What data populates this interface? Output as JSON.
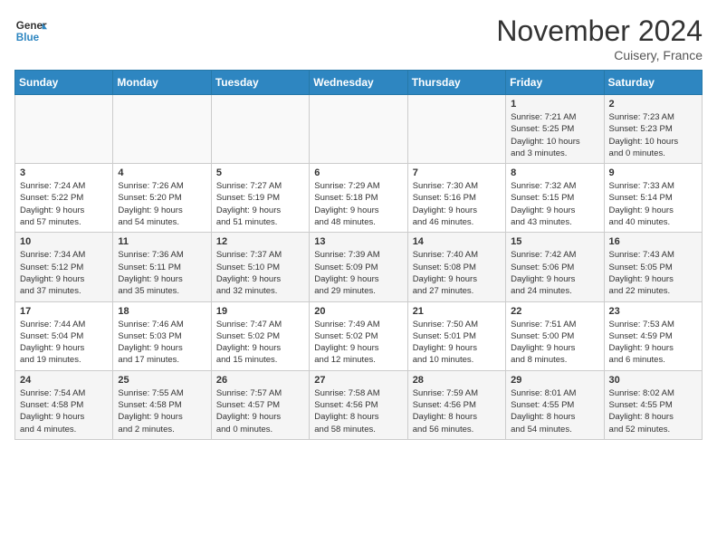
{
  "header": {
    "logo_line1": "General",
    "logo_line2": "Blue",
    "month": "November 2024",
    "location": "Cuisery, France"
  },
  "weekdays": [
    "Sunday",
    "Monday",
    "Tuesday",
    "Wednesday",
    "Thursday",
    "Friday",
    "Saturday"
  ],
  "weeks": [
    [
      {
        "day": "",
        "info": ""
      },
      {
        "day": "",
        "info": ""
      },
      {
        "day": "",
        "info": ""
      },
      {
        "day": "",
        "info": ""
      },
      {
        "day": "",
        "info": ""
      },
      {
        "day": "1",
        "info": "Sunrise: 7:21 AM\nSunset: 5:25 PM\nDaylight: 10 hours\nand 3 minutes."
      },
      {
        "day": "2",
        "info": "Sunrise: 7:23 AM\nSunset: 5:23 PM\nDaylight: 10 hours\nand 0 minutes."
      }
    ],
    [
      {
        "day": "3",
        "info": "Sunrise: 7:24 AM\nSunset: 5:22 PM\nDaylight: 9 hours\nand 57 minutes."
      },
      {
        "day": "4",
        "info": "Sunrise: 7:26 AM\nSunset: 5:20 PM\nDaylight: 9 hours\nand 54 minutes."
      },
      {
        "day": "5",
        "info": "Sunrise: 7:27 AM\nSunset: 5:19 PM\nDaylight: 9 hours\nand 51 minutes."
      },
      {
        "day": "6",
        "info": "Sunrise: 7:29 AM\nSunset: 5:18 PM\nDaylight: 9 hours\nand 48 minutes."
      },
      {
        "day": "7",
        "info": "Sunrise: 7:30 AM\nSunset: 5:16 PM\nDaylight: 9 hours\nand 46 minutes."
      },
      {
        "day": "8",
        "info": "Sunrise: 7:32 AM\nSunset: 5:15 PM\nDaylight: 9 hours\nand 43 minutes."
      },
      {
        "day": "9",
        "info": "Sunrise: 7:33 AM\nSunset: 5:14 PM\nDaylight: 9 hours\nand 40 minutes."
      }
    ],
    [
      {
        "day": "10",
        "info": "Sunrise: 7:34 AM\nSunset: 5:12 PM\nDaylight: 9 hours\nand 37 minutes."
      },
      {
        "day": "11",
        "info": "Sunrise: 7:36 AM\nSunset: 5:11 PM\nDaylight: 9 hours\nand 35 minutes."
      },
      {
        "day": "12",
        "info": "Sunrise: 7:37 AM\nSunset: 5:10 PM\nDaylight: 9 hours\nand 32 minutes."
      },
      {
        "day": "13",
        "info": "Sunrise: 7:39 AM\nSunset: 5:09 PM\nDaylight: 9 hours\nand 29 minutes."
      },
      {
        "day": "14",
        "info": "Sunrise: 7:40 AM\nSunset: 5:08 PM\nDaylight: 9 hours\nand 27 minutes."
      },
      {
        "day": "15",
        "info": "Sunrise: 7:42 AM\nSunset: 5:06 PM\nDaylight: 9 hours\nand 24 minutes."
      },
      {
        "day": "16",
        "info": "Sunrise: 7:43 AM\nSunset: 5:05 PM\nDaylight: 9 hours\nand 22 minutes."
      }
    ],
    [
      {
        "day": "17",
        "info": "Sunrise: 7:44 AM\nSunset: 5:04 PM\nDaylight: 9 hours\nand 19 minutes."
      },
      {
        "day": "18",
        "info": "Sunrise: 7:46 AM\nSunset: 5:03 PM\nDaylight: 9 hours\nand 17 minutes."
      },
      {
        "day": "19",
        "info": "Sunrise: 7:47 AM\nSunset: 5:02 PM\nDaylight: 9 hours\nand 15 minutes."
      },
      {
        "day": "20",
        "info": "Sunrise: 7:49 AM\nSunset: 5:02 PM\nDaylight: 9 hours\nand 12 minutes."
      },
      {
        "day": "21",
        "info": "Sunrise: 7:50 AM\nSunset: 5:01 PM\nDaylight: 9 hours\nand 10 minutes."
      },
      {
        "day": "22",
        "info": "Sunrise: 7:51 AM\nSunset: 5:00 PM\nDaylight: 9 hours\nand 8 minutes."
      },
      {
        "day": "23",
        "info": "Sunrise: 7:53 AM\nSunset: 4:59 PM\nDaylight: 9 hours\nand 6 minutes."
      }
    ],
    [
      {
        "day": "24",
        "info": "Sunrise: 7:54 AM\nSunset: 4:58 PM\nDaylight: 9 hours\nand 4 minutes."
      },
      {
        "day": "25",
        "info": "Sunrise: 7:55 AM\nSunset: 4:58 PM\nDaylight: 9 hours\nand 2 minutes."
      },
      {
        "day": "26",
        "info": "Sunrise: 7:57 AM\nSunset: 4:57 PM\nDaylight: 9 hours\nand 0 minutes."
      },
      {
        "day": "27",
        "info": "Sunrise: 7:58 AM\nSunset: 4:56 PM\nDaylight: 8 hours\nand 58 minutes."
      },
      {
        "day": "28",
        "info": "Sunrise: 7:59 AM\nSunset: 4:56 PM\nDaylight: 8 hours\nand 56 minutes."
      },
      {
        "day": "29",
        "info": "Sunrise: 8:01 AM\nSunset: 4:55 PM\nDaylight: 8 hours\nand 54 minutes."
      },
      {
        "day": "30",
        "info": "Sunrise: 8:02 AM\nSunset: 4:55 PM\nDaylight: 8 hours\nand 52 minutes."
      }
    ]
  ]
}
